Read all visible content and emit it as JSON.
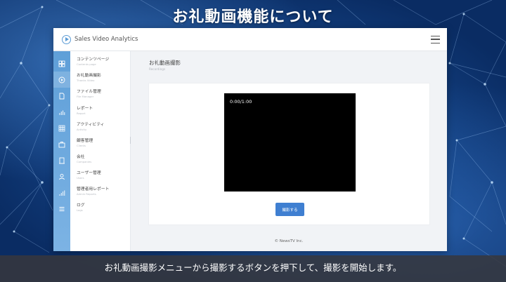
{
  "slide": {
    "title": "お礼動画機能について",
    "caption": "お礼動画撮影メニューから撮影するボタンを押下して、撮影を開始します。"
  },
  "app": {
    "title": "Sales Video Analytics",
    "accent_color": "#5b9bd5",
    "button_color": "#3f7fd1"
  },
  "iconbar": {
    "icons": [
      "dashboard-icon",
      "play-circle-icon",
      "file-icon",
      "bar-chart-icon",
      "grid-icon",
      "briefcase-icon",
      "building-icon",
      "user-icon",
      "signal-icon",
      "list-icon"
    ]
  },
  "nav": {
    "items": [
      {
        "label": "コンテンツページ",
        "sub": "Contents page"
      },
      {
        "label": "お礼動画撮影",
        "sub": "Thanks Video"
      },
      {
        "label": "ファイル管理",
        "sub": "File Manager"
      },
      {
        "label": "レポート",
        "sub": "Report"
      },
      {
        "label": "アクティビティ",
        "sub": "Activity"
      },
      {
        "label": "顧客管理",
        "sub": "Clients"
      },
      {
        "label": "会社",
        "sub": "Companies"
      },
      {
        "label": "ユーザー管理",
        "sub": "Users"
      },
      {
        "label": "管理者用レポート",
        "sub": "Admin Reports"
      },
      {
        "label": "ログ",
        "sub": "Logs"
      }
    ]
  },
  "main": {
    "page_title": "お礼動画撮影",
    "page_subtitle": "Recordings",
    "video_time": "0:00/1:00",
    "record_button": "撮影する",
    "footer": "© NewsTV Inc."
  }
}
